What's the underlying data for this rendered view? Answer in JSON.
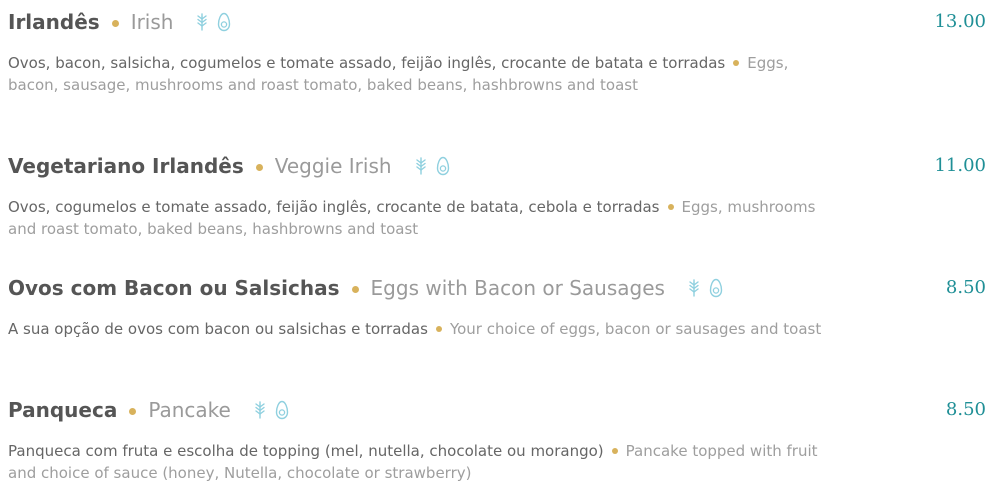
{
  "colors": {
    "gold": "#d8b25c",
    "teal": "#1f8f96",
    "icon_blue": "#8fd0df"
  },
  "menu": {
    "items": [
      {
        "name_pt": "Irlandês",
        "name_en": "Irish",
        "price": "13.00",
        "desc_pt": "Ovos, bacon, salsicha, cogumelos e tomate assado, feijão inglês, crocante de batata e torradas",
        "desc_en": "Eggs, bacon, sausage, mushrooms and roast tomato, baked beans, hashbrowns and toast",
        "icons": [
          "wheat-icon",
          "egg-icon"
        ]
      },
      {
        "name_pt": "Vegetariano Irlandês",
        "name_en": "Veggie Irish",
        "price": "11.00",
        "desc_pt": "Ovos, cogumelos e tomate assado, feijão inglês, crocante de batata, cebola e torradas",
        "desc_en": "Eggs, mushrooms and roast tomato, baked beans, hashbrowns and toast",
        "icons": [
          "wheat-icon",
          "egg-icon"
        ]
      },
      {
        "name_pt": "Ovos com Bacon ou Salsichas",
        "name_en": "Eggs with Bacon or Sausages",
        "price": "8.50",
        "desc_pt": "A sua opção de ovos com bacon ou salsichas e torradas",
        "desc_en": "Your choice of eggs, bacon or sausages and toast",
        "icons": [
          "wheat-icon",
          "egg-icon"
        ]
      },
      {
        "name_pt": "Panqueca",
        "name_en": "Pancake",
        "price": "8.50",
        "desc_pt": "Panqueca com fruta e escolha de topping (mel, nutella, chocolate ou morango)",
        "desc_en": "Pancake topped with fruit and choice of sauce (honey, Nutella, chocolate or strawberry)",
        "icons": [
          "wheat-icon",
          "egg-icon"
        ]
      }
    ]
  }
}
